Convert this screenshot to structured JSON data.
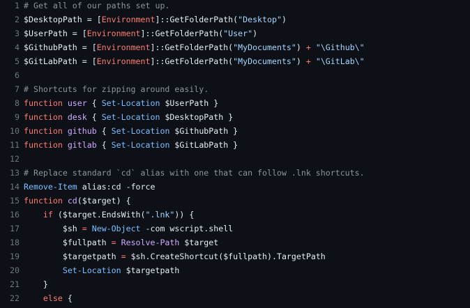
{
  "colors": {
    "background": "#0d1117",
    "line_number": "#6e7681",
    "text": "#e6edf3",
    "comment": "#8b949e",
    "keyword": "#ff7b72",
    "string": "#a5d6ff",
    "function": "#d2a8ff",
    "variable": "#79c0ff",
    "type": "#ffa657"
  },
  "lines": [
    {
      "n": "1",
      "tokens": [
        {
          "t": "# Get all of our paths set up.",
          "c": "comment"
        }
      ]
    },
    {
      "n": "2",
      "tokens": [
        {
          "t": "$DesktopPath = [",
          "c": "text"
        },
        {
          "t": "Environment",
          "c": "keyword"
        },
        {
          "t": "]::GetFolderPath(",
          "c": "text"
        },
        {
          "t": "\"Desktop\"",
          "c": "string"
        },
        {
          "t": ")",
          "c": "text"
        }
      ]
    },
    {
      "n": "3",
      "tokens": [
        {
          "t": "$UserPath = [",
          "c": "text"
        },
        {
          "t": "Environment",
          "c": "keyword"
        },
        {
          "t": "]::GetFolderPath(",
          "c": "text"
        },
        {
          "t": "\"User\"",
          "c": "string"
        },
        {
          "t": ")",
          "c": "text"
        }
      ]
    },
    {
      "n": "4",
      "tokens": [
        {
          "t": "$GithubPath = [",
          "c": "text"
        },
        {
          "t": "Environment",
          "c": "keyword"
        },
        {
          "t": "]::GetFolderPath(",
          "c": "text"
        },
        {
          "t": "\"MyDocuments\"",
          "c": "string"
        },
        {
          "t": ") ",
          "c": "text"
        },
        {
          "t": "+",
          "c": "keyword"
        },
        {
          "t": " ",
          "c": "text"
        },
        {
          "t": "\"\\Github\\\"",
          "c": "string"
        }
      ]
    },
    {
      "n": "5",
      "tokens": [
        {
          "t": "$GitLabPath = [",
          "c": "text"
        },
        {
          "t": "Environment",
          "c": "keyword"
        },
        {
          "t": "]::GetFolderPath(",
          "c": "text"
        },
        {
          "t": "\"MyDocuments\"",
          "c": "string"
        },
        {
          "t": ") ",
          "c": "text"
        },
        {
          "t": "+",
          "c": "keyword"
        },
        {
          "t": " ",
          "c": "text"
        },
        {
          "t": "\"\\GitLab\\\"",
          "c": "string"
        }
      ]
    },
    {
      "n": "6",
      "tokens": []
    },
    {
      "n": "7",
      "tokens": [
        {
          "t": "# Shortcuts for zipping around easily.",
          "c": "comment"
        }
      ]
    },
    {
      "n": "8",
      "tokens": [
        {
          "t": "function",
          "c": "keyword"
        },
        {
          "t": " ",
          "c": "text"
        },
        {
          "t": "user",
          "c": "function"
        },
        {
          "t": " { ",
          "c": "text"
        },
        {
          "t": "Set-Location",
          "c": "variable"
        },
        {
          "t": " $UserPath }",
          "c": "text"
        }
      ]
    },
    {
      "n": "9",
      "tokens": [
        {
          "t": "function",
          "c": "keyword"
        },
        {
          "t": " ",
          "c": "text"
        },
        {
          "t": "desk",
          "c": "function"
        },
        {
          "t": " { ",
          "c": "text"
        },
        {
          "t": "Set-Location",
          "c": "variable"
        },
        {
          "t": " $DesktopPath }",
          "c": "text"
        }
      ]
    },
    {
      "n": "10",
      "tokens": [
        {
          "t": "function",
          "c": "keyword"
        },
        {
          "t": " ",
          "c": "text"
        },
        {
          "t": "github",
          "c": "function"
        },
        {
          "t": " { ",
          "c": "text"
        },
        {
          "t": "Set-Location",
          "c": "variable"
        },
        {
          "t": " $GithubPath }",
          "c": "text"
        }
      ]
    },
    {
      "n": "11",
      "tokens": [
        {
          "t": "function",
          "c": "keyword"
        },
        {
          "t": " ",
          "c": "text"
        },
        {
          "t": "gitlab",
          "c": "function"
        },
        {
          "t": " { ",
          "c": "text"
        },
        {
          "t": "Set-Location",
          "c": "variable"
        },
        {
          "t": " $GitLabPath }",
          "c": "text"
        }
      ]
    },
    {
      "n": "12",
      "tokens": []
    },
    {
      "n": "13",
      "tokens": [
        {
          "t": "# Replace standard `cd` alias with one that can follow .lnk shortcuts.",
          "c": "comment"
        }
      ]
    },
    {
      "n": "14",
      "tokens": [
        {
          "t": "Remove-Item",
          "c": "variable"
        },
        {
          "t": " alias:cd ",
          "c": "text"
        },
        {
          "t": "-force",
          "c": "text"
        }
      ]
    },
    {
      "n": "15",
      "tokens": [
        {
          "t": "function",
          "c": "keyword"
        },
        {
          "t": " ",
          "c": "text"
        },
        {
          "t": "cd",
          "c": "function"
        },
        {
          "t": "($target) {",
          "c": "text"
        }
      ]
    },
    {
      "n": "16",
      "tokens": [
        {
          "t": "    ",
          "c": "text"
        },
        {
          "t": "if",
          "c": "keyword"
        },
        {
          "t": " ($target.EndsWith(",
          "c": "text"
        },
        {
          "t": "\".lnk\"",
          "c": "string"
        },
        {
          "t": ")) {",
          "c": "text"
        }
      ]
    },
    {
      "n": "17",
      "tokens": [
        {
          "t": "        $sh ",
          "c": "text"
        },
        {
          "t": "=",
          "c": "keyword"
        },
        {
          "t": " ",
          "c": "text"
        },
        {
          "t": "New-Object",
          "c": "variable"
        },
        {
          "t": " -com wscript.shell",
          "c": "text"
        }
      ]
    },
    {
      "n": "18",
      "tokens": [
        {
          "t": "        $fullpath ",
          "c": "text"
        },
        {
          "t": "=",
          "c": "keyword"
        },
        {
          "t": " ",
          "c": "text"
        },
        {
          "t": "Resolve-Path",
          "c": "function"
        },
        {
          "t": " $target",
          "c": "text"
        }
      ]
    },
    {
      "n": "19",
      "tokens": [
        {
          "t": "        $targetpath ",
          "c": "text"
        },
        {
          "t": "=",
          "c": "keyword"
        },
        {
          "t": " $sh.CreateShortcut($fullpath).TargetPath",
          "c": "text"
        }
      ]
    },
    {
      "n": "20",
      "tokens": [
        {
          "t": "        ",
          "c": "text"
        },
        {
          "t": "Set-Location",
          "c": "variable"
        },
        {
          "t": " $targetpath",
          "c": "text"
        }
      ]
    },
    {
      "n": "21",
      "tokens": [
        {
          "t": "    }",
          "c": "text"
        }
      ]
    },
    {
      "n": "22",
      "tokens": [
        {
          "t": "    ",
          "c": "text"
        },
        {
          "t": "else",
          "c": "keyword"
        },
        {
          "t": " {",
          "c": "text"
        }
      ]
    }
  ]
}
